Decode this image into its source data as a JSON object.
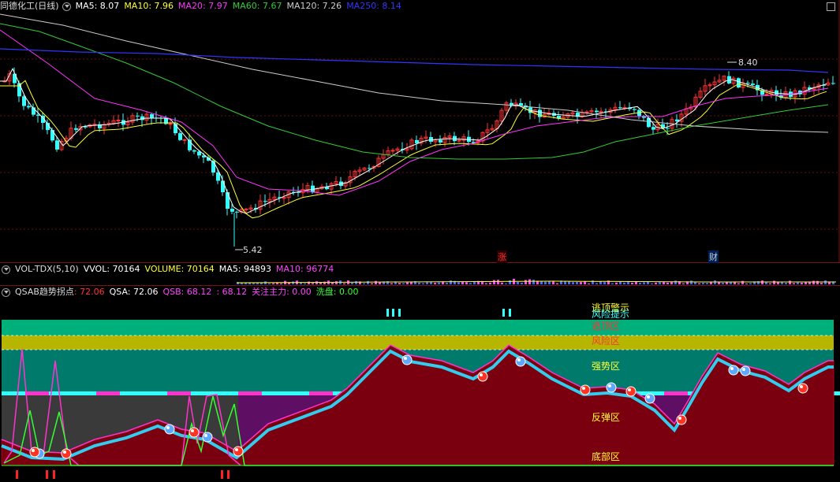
{
  "main": {
    "title": "同德化工(日线)",
    "ma": [
      {
        "label": "MA5: 8.07",
        "color": "#ffffff"
      },
      {
        "label": "MA10: 7.96",
        "color": "#ffff33"
      },
      {
        "label": "MA20: 7.97",
        "color": "#ff33ff"
      },
      {
        "label": "MA60: 7.67",
        "color": "#33cc33"
      },
      {
        "label": "MA120: 7.26",
        "color": "#cccccc"
      },
      {
        "label": "MA250: 8.14",
        "color": "#3333ff"
      }
    ],
    "high_label": "8.40",
    "low_label": "5.42",
    "marker_zhang": "涨",
    "marker_cai": "财"
  },
  "vol": {
    "title": "VOL-TDX(5,10)",
    "items": [
      {
        "label": "VVOL: 70164",
        "color": "#ffffff"
      },
      {
        "label": "VOLUME: 70164",
        "color": "#ffff33"
      },
      {
        "label": "MA5: 94893",
        "color": "#ffffff"
      },
      {
        "label": "MA10: 96774",
        "color": "#ff44ff"
      }
    ]
  },
  "qsab": {
    "title": "QSAB趋势拐点",
    "items": [
      {
        "label": ": 72.06",
        "color": "#ff3333"
      },
      {
        "label": "QSA: 72.06",
        "color": "#ffffff"
      },
      {
        "label": "QSB: 68.12",
        "color": "#ff44ff"
      },
      {
        "label": ": 68.12",
        "color": "#ff44ff"
      },
      {
        "label": "关注主力: 0.00",
        "color": "#ff44ff"
      },
      {
        "label": "洗盘: 0.00",
        "color": "#33ff33"
      }
    ],
    "zones": {
      "escape_warn": "逃顶警示",
      "risk_hint": "风险提示",
      "escape_zone": "逃顶区",
      "risk_zone": "风险区",
      "strong_zone": "强势区",
      "rebound_zone": "反弹区",
      "bottom_zone": "底部区"
    }
  },
  "colors": {
    "up": "#ff3333",
    "down": "#33ffff",
    "ma5": "#ffffff",
    "ma10": "#ffff33",
    "ma20": "#ff33ff",
    "ma60": "#33cc33",
    "ma120": "#cccccc",
    "ma250": "#3333ff",
    "border": "#7a1010"
  }
}
